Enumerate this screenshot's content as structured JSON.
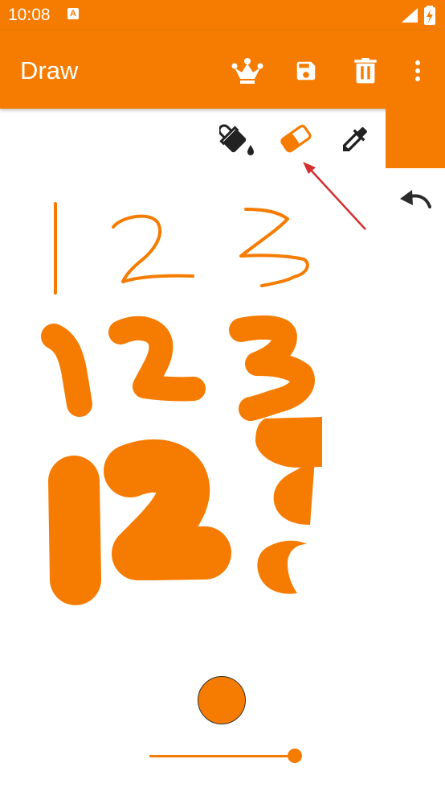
{
  "status_bar": {
    "time": "10:08",
    "notification_icon": "a-icon",
    "signal_icon": "signal-icon",
    "battery_icon": "battery-charging-icon"
  },
  "app_bar": {
    "title": "Draw",
    "actions": [
      "crown-icon",
      "save-icon",
      "delete-icon",
      "more-vert-icon"
    ]
  },
  "tools": {
    "fill": "fill-bucket-icon",
    "eraser": "eraser-icon",
    "eyedropper": "eyedropper-icon",
    "undo": "undo-icon"
  },
  "brush": {
    "color": "#f57c00",
    "size_fraction": 1.0
  },
  "colors": {
    "accent": "#f57c00",
    "annotation": "#d32f2f"
  }
}
